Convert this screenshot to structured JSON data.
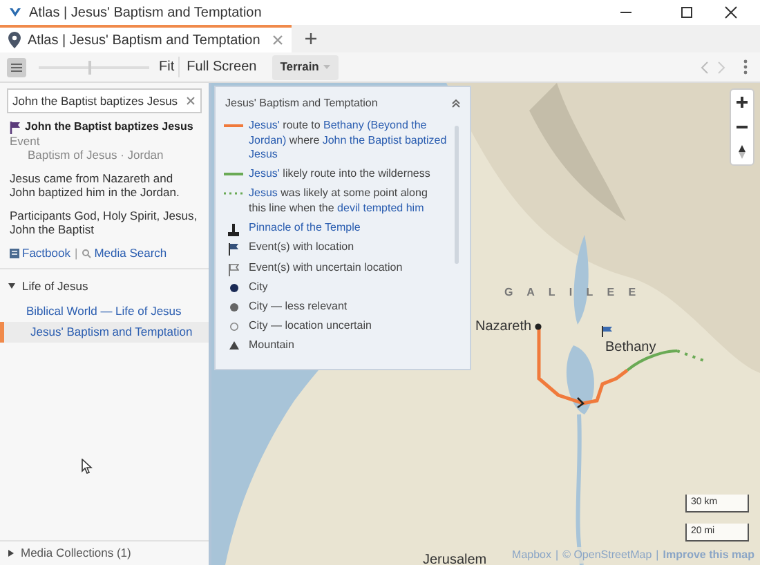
{
  "window": {
    "title": "Atlas | Jesus' Baptism and Temptation"
  },
  "tabs": [
    {
      "label": "Atlas | Jesus' Baptism and Temptation",
      "selected": true
    }
  ],
  "toolbar": {
    "fit": "Fit",
    "full_screen": "Full Screen",
    "layer": "Terrain",
    "zoom_slider": {
      "level": 0.45
    }
  },
  "search": {
    "value": "John the Baptist baptizes Jesus"
  },
  "event": {
    "title": "John the Baptist baptizes Jesus",
    "type": "Event",
    "place": "Baptism of Jesus · Jordan",
    "description": "Jesus came from Nazareth and John baptized him in the Jordan.",
    "participants": "Participants God, Holy Spirit, Jesus, John the Baptist",
    "links": [
      "Factbook",
      "|",
      "Media Search"
    ]
  },
  "sections": [
    {
      "label": "Life of Jesus",
      "expanded": true,
      "items": [
        {
          "label": "Biblical World — Life of Jesus",
          "selected": false
        },
        {
          "label": "Jesus' Baptism and Temptation",
          "selected": true
        }
      ]
    }
  ],
  "footer_section": {
    "label": "Media Collections (1)",
    "expanded": false
  },
  "legend": {
    "title": "Jesus' Baptism and Temptation",
    "items": [
      {
        "kind": "line",
        "color": "#f07a3c",
        "parts": [
          {
            "text": "Jesus'",
            "link": true
          },
          {
            "text": " route to ",
            "link": false
          },
          {
            "text": "Bethany (Beyond the Jordan)",
            "link": true
          },
          {
            "text": " where ",
            "link": false
          },
          {
            "text": "John the Baptist baptized Jesus",
            "link": true
          }
        ]
      },
      {
        "kind": "line",
        "color": "#6aaa55",
        "parts": [
          {
            "text": "Jesus'",
            "link": true
          },
          {
            "text": " likely route into the wilderness",
            "link": false
          }
        ]
      },
      {
        "kind": "dotted",
        "color": "#6aaa55",
        "parts": [
          {
            "text": "Jesus",
            "link": true
          },
          {
            "text": " was likely at some point along this line when the ",
            "link": false
          },
          {
            "text": "devil tempted him",
            "link": true
          }
        ]
      },
      {
        "kind": "pinnacle",
        "parts": [
          {
            "text": "Pinnacle of the Temple",
            "link": true
          }
        ]
      },
      {
        "kind": "flag",
        "parts": [
          {
            "text": "Event(s) with location",
            "link": false
          }
        ]
      },
      {
        "kind": "flag-outline",
        "parts": [
          {
            "text": "Event(s) with uncertain location",
            "link": false
          }
        ]
      },
      {
        "kind": "city",
        "parts": [
          {
            "text": "City",
            "link": false
          }
        ]
      },
      {
        "kind": "city-minor",
        "parts": [
          {
            "text": "City — less relevant",
            "link": false
          }
        ]
      },
      {
        "kind": "city-uncertain",
        "parts": [
          {
            "text": "City — location uncertain",
            "link": false
          }
        ]
      },
      {
        "kind": "mountain",
        "parts": [
          {
            "text": "Mountain",
            "link": false
          }
        ]
      }
    ]
  },
  "map": {
    "region": "G A L I L E E",
    "places": [
      {
        "kind": "city",
        "label": "Nazareth"
      },
      {
        "kind": "event",
        "label": "Bethany"
      },
      {
        "kind": "plain",
        "label": "Jerusalem"
      }
    ],
    "scale": [
      "30 km",
      "20 mi"
    ],
    "attribution": [
      "Mapbox",
      "|",
      "© OpenStreetMap",
      "|",
      "Improve this map"
    ]
  }
}
